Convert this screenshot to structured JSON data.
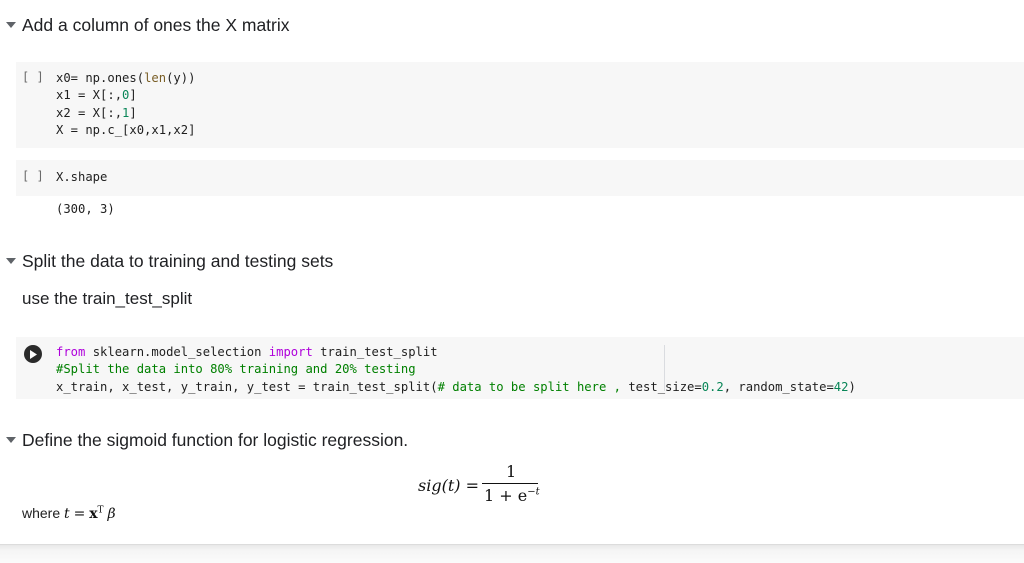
{
  "sections": [
    {
      "heading": "Add a column of ones the X matrix"
    },
    {
      "heading": "Split the data to training and testing sets",
      "text": "use the train_test_split"
    },
    {
      "heading": "Define the sigmoid function for logistic regression."
    }
  ],
  "cells": {
    "cell1": {
      "bracket": "[ ]",
      "line1_a": "x0= np.ones(",
      "line1_fn": "len",
      "line1_b": "(y))",
      "line2_a": "x1 = X[:,",
      "line2_num": "0",
      "line2_b": "]",
      "line3_a": "x2 = X[:,",
      "line3_num": "1",
      "line3_b": "]",
      "line4": "X = np.c_[x0,x1,x2]"
    },
    "cell2": {
      "bracket": "[ ]",
      "code": "X.shape",
      "output": "(300, 3)"
    },
    "cell3": {
      "line1_kw1": "from",
      "line1_mid": " sklearn.model_selection ",
      "line1_kw2": "import",
      "line1_end": " train_test_split",
      "line2_comment": "#Split the data into 80% training and 20% testing",
      "line3_a": "x_train, x_test, y_train, y_test = train_test_split(",
      "line3_comment": "# data to be split here , ",
      "line3_b": "test_size=",
      "line3_num1": "0.2",
      "line3_c": ", random_state=",
      "line3_num2": "42",
      "line3_d": ")"
    }
  },
  "math": {
    "sig_lhs": "sig(t) =",
    "numerator": "1",
    "denominator": "1 + e",
    "exponent": "−t",
    "where_label": "where",
    "where_expr_t": "t",
    "where_eq": "=",
    "where_x": "x",
    "where_T": "T",
    "where_beta": "β"
  },
  "icons": {
    "caret": "caret-down-icon",
    "run": "play-circle-icon"
  },
  "colors": {
    "cell_bg": "#f7f7f7",
    "keyword": "#af00db",
    "comment": "#008000",
    "number": "#098658"
  }
}
